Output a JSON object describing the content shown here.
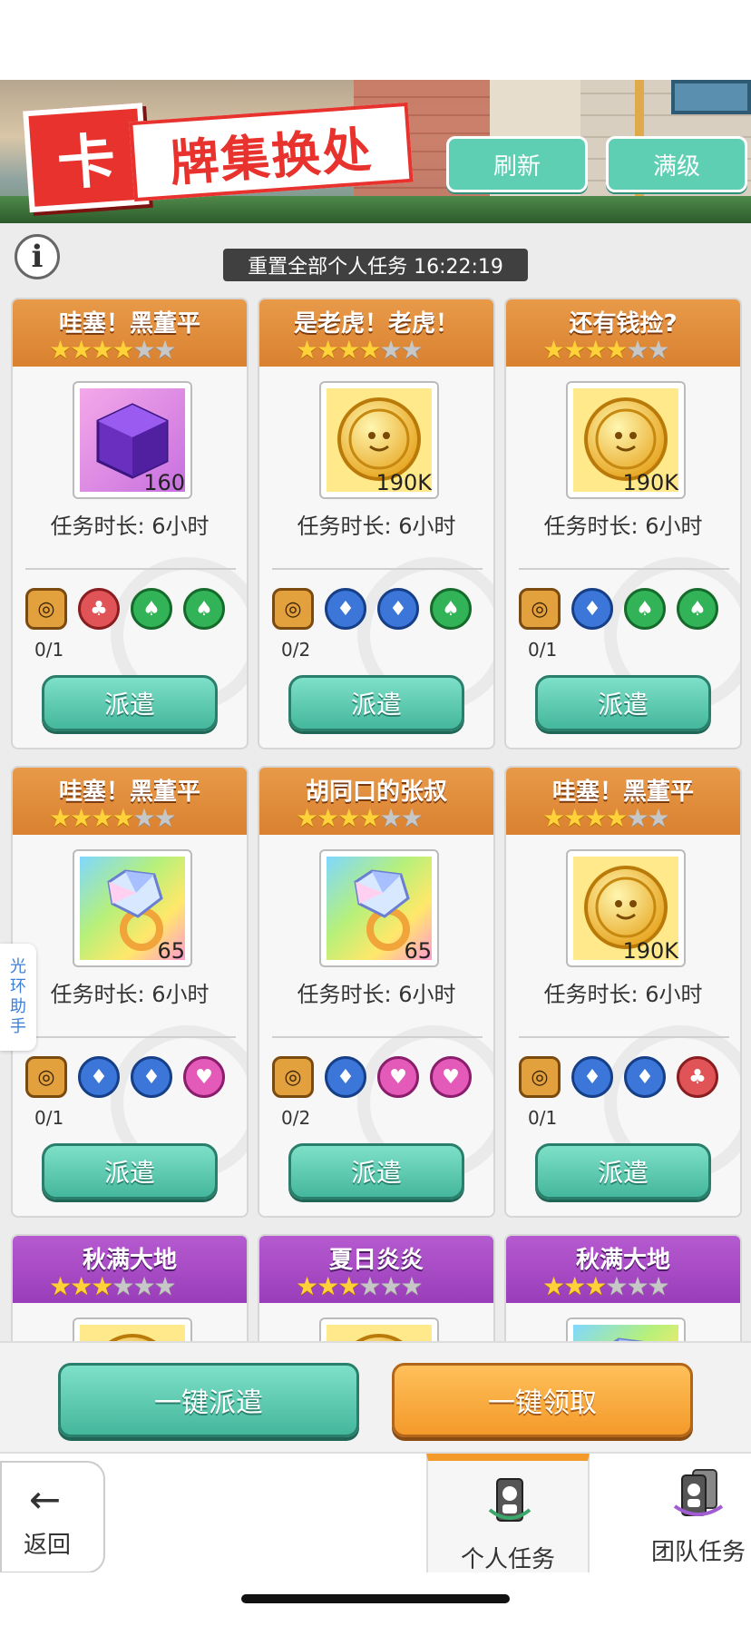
{
  "header": {
    "title_first": "卡",
    "title_rest": "牌集换处",
    "refresh_label": "刷新",
    "max_level_label": "满级"
  },
  "info": {
    "reset_text": "重置全部个人任务 16:22:19"
  },
  "cards": [
    {
      "title": "哇塞！黑董平",
      "stars": 4,
      "item": "purple-cube",
      "qty": "160",
      "duration": "任务时长: 6小时",
      "reqs": [
        "hex",
        "red",
        "green",
        "green"
      ],
      "count": "0/1",
      "button": "派遣"
    },
    {
      "title": "是老虎！老虎！",
      "stars": 4,
      "item": "gold-coin",
      "qty": "190K",
      "duration": "任务时长: 6小时",
      "reqs": [
        "hex",
        "blue",
        "blue",
        "green"
      ],
      "count": "0/2",
      "button": "派遣"
    },
    {
      "title": "还有钱捡?",
      "stars": 4,
      "item": "gold-coin",
      "qty": "190K",
      "duration": "任务时长: 6小时",
      "reqs": [
        "hex",
        "blue",
        "green",
        "green"
      ],
      "count": "0/1",
      "button": "派遣"
    },
    {
      "title": "哇塞！黑董平",
      "stars": 4,
      "item": "rainbow-ring",
      "qty": "65",
      "duration": "任务时长: 6小时",
      "reqs": [
        "hex",
        "blue",
        "blue",
        "pink"
      ],
      "count": "0/1",
      "button": "派遣"
    },
    {
      "title": "胡同口的张叔",
      "stars": 4,
      "item": "rainbow-ring",
      "qty": "65",
      "duration": "任务时长: 6小时",
      "reqs": [
        "hex",
        "blue",
        "pink",
        "pink"
      ],
      "count": "0/2",
      "button": "派遣"
    },
    {
      "title": "哇塞！黑董平",
      "stars": 4,
      "item": "gold-coin",
      "qty": "190K",
      "duration": "任务时长: 6小时",
      "reqs": [
        "hex",
        "blue",
        "blue",
        "red"
      ],
      "count": "0/1",
      "button": "派遣"
    },
    {
      "title": "秋满大地",
      "stars": 3,
      "item": "gold-coin",
      "qty": "",
      "duration": "",
      "reqs": [],
      "count": "",
      "button": "",
      "purple": true
    },
    {
      "title": "夏日炎炎",
      "stars": 3,
      "item": "gold-coin",
      "qty": "",
      "duration": "",
      "reqs": [],
      "count": "",
      "button": "",
      "purple": true
    },
    {
      "title": "秋满大地",
      "stars": 3,
      "item": "rainbow-ring",
      "qty": "",
      "duration": "",
      "reqs": [],
      "count": "",
      "button": "",
      "purple": true
    }
  ],
  "side_tab": {
    "label": "光环助手"
  },
  "footer": {
    "dispatch_all_label": "一键派遣",
    "collect_all_label": "一键领取"
  },
  "nav": {
    "back_label": "返回",
    "personal_tab_label": "个人任务",
    "team_tab_label": "团队任务"
  }
}
